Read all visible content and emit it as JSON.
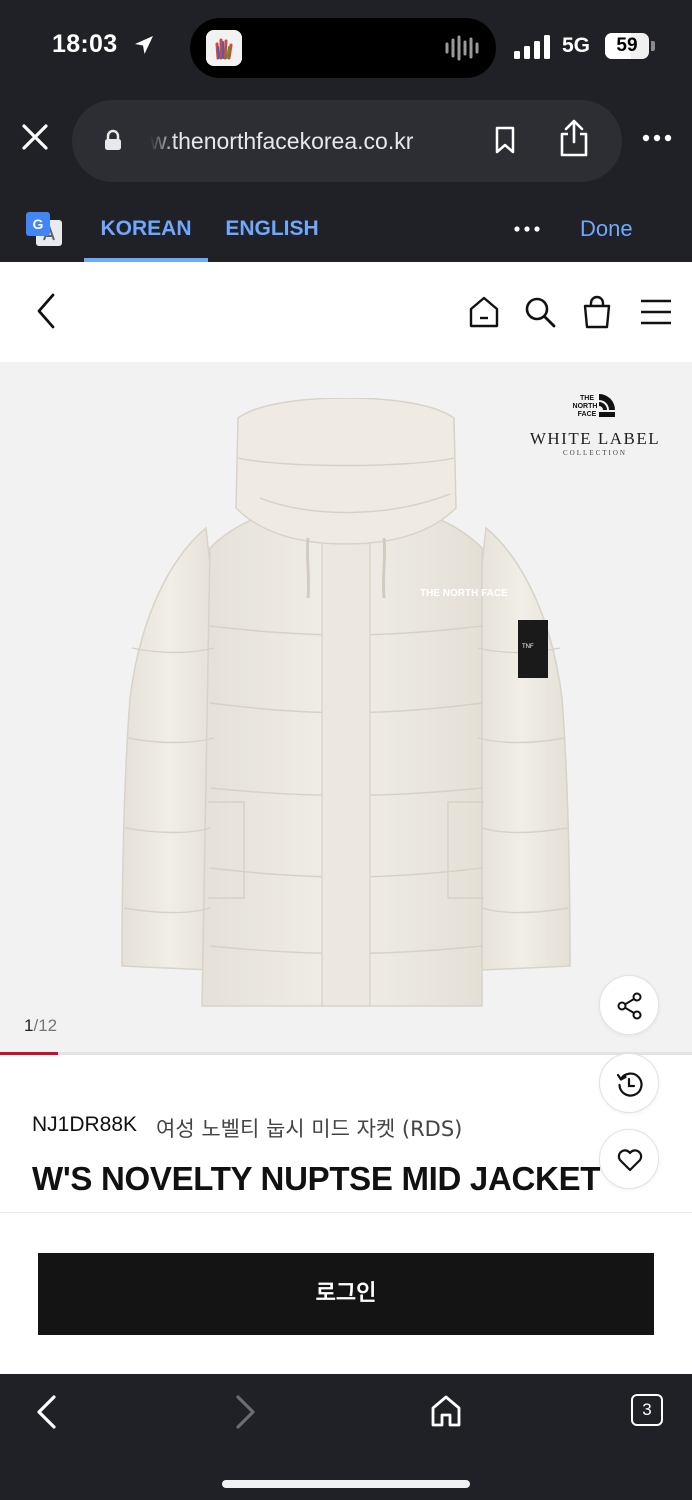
{
  "status_bar": {
    "time": "18:03",
    "network": "5G",
    "battery": "59",
    "battery_level_percent": 59
  },
  "browser": {
    "url": "w.thenorthfacekorea.co.kr",
    "icons": [
      "close-icon",
      "lock-icon",
      "bookmark-icon",
      "share-icon",
      "more-icon"
    ]
  },
  "translate_bar": {
    "tab_korean": "KOREAN",
    "tab_english": "ENGLISH",
    "active_tab": "KOREAN",
    "done": "Done",
    "accent_color": "#6ea8ff"
  },
  "site_header": {
    "icons": [
      "chevron-left-icon",
      "home-icon",
      "search-icon",
      "cart-icon",
      "menu-icon"
    ]
  },
  "gallery": {
    "brand_mark": "THE NORTH FACE",
    "brand_title": "WHITE LABEL",
    "brand_sub": "COLLECTION",
    "counter_current": "1",
    "counter_total": "/12",
    "progress_fraction": 0.0833,
    "progress_color": "#c8102e"
  },
  "product": {
    "code": "NJ1DR88K",
    "korean_name": "여성 노벨티 눕시 미드 자켓 (RDS)",
    "name": "W'S NOVELTY NUPTSE MID JACKET"
  },
  "login": {
    "label": "로그인"
  },
  "bottom_bar": {
    "tab_count": "3"
  }
}
